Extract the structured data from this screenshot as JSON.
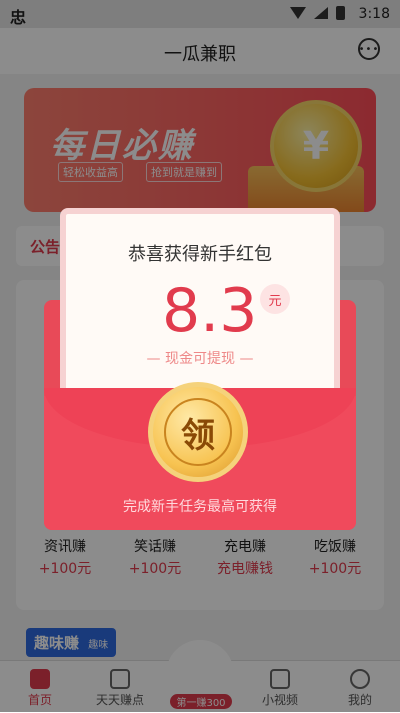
{
  "status_bar": {
    "app_icon": "忠",
    "time": "3:18"
  },
  "header": {
    "title": "一瓜兼职",
    "more_icon": "more-icon"
  },
  "banner": {
    "title": "每日必赚",
    "tag1": "轻松收益高",
    "tag2": "抢到就是赚到",
    "coin_symbol": "¥"
  },
  "notice": {
    "label": "公告"
  },
  "grid_items": [
    {
      "name": "资讯赚",
      "sub": "+100元"
    },
    {
      "name": "笑话赚",
      "sub": "+100元"
    },
    {
      "name": "充电赚",
      "sub": "充电赚钱"
    },
    {
      "name": "吃饭赚",
      "sub": "+100元"
    }
  ],
  "fun_tag": "趣味赚",
  "fun_tag_sub": "趣味",
  "bottom_nav": [
    {
      "label": "首页",
      "active": true
    },
    {
      "label": "天天赚点",
      "active": false
    },
    {
      "label": "小视频",
      "active": false
    },
    {
      "label": "我的",
      "active": false
    }
  ],
  "trophy_badge": "第一赚300",
  "modal": {
    "title": "恭喜获得新手红包",
    "amount": "8.3",
    "unit": "元",
    "cash_line": "— 现金可提现 —",
    "coin_label": "领",
    "hint": "完成新手任务最高可获得"
  },
  "colors": {
    "accent": "#e13b4d",
    "envelope": "#f04a5c",
    "gold": "#f7c351"
  }
}
